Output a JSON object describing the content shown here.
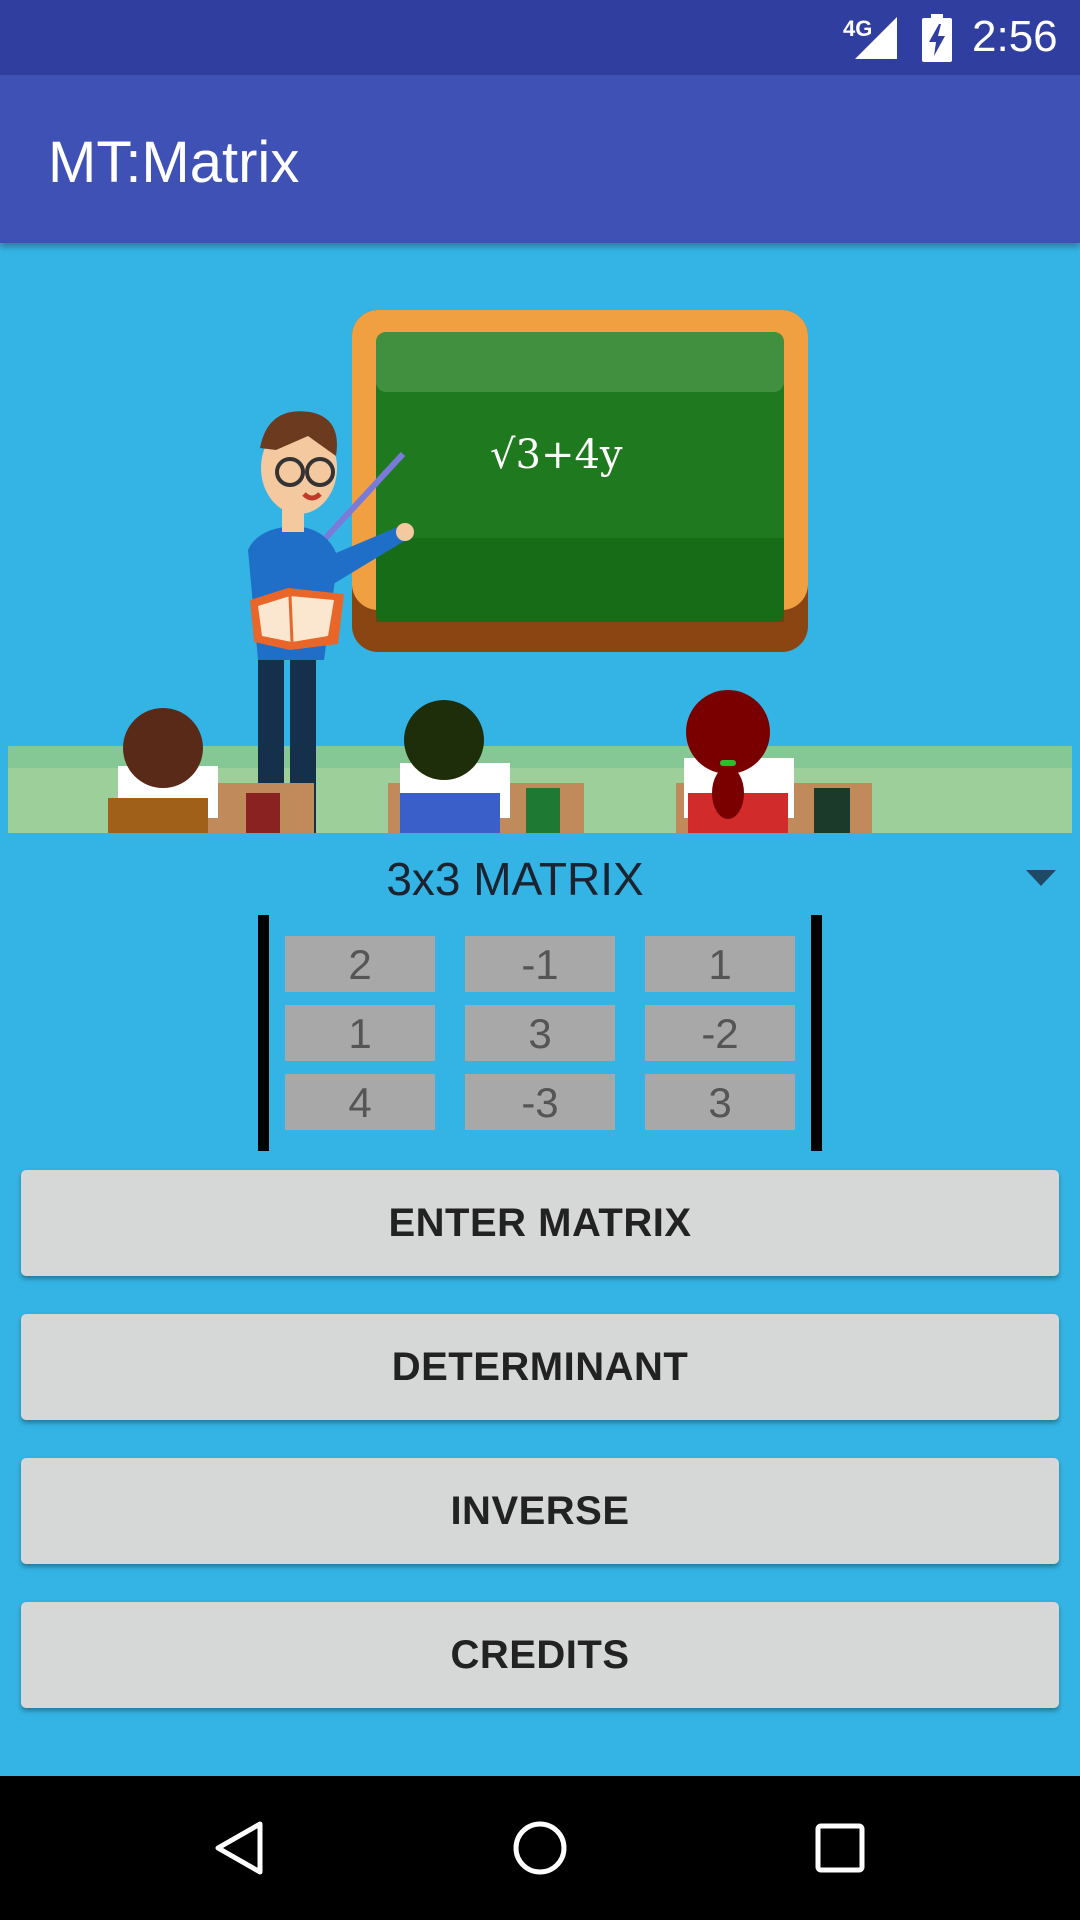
{
  "status_bar": {
    "network": "4G",
    "time": "2:56"
  },
  "app_bar": {
    "title": "MT:Matrix"
  },
  "spinner": {
    "selected": "3x3 MATRIX"
  },
  "matrix": [
    [
      "2",
      "-1",
      "1"
    ],
    [
      "1",
      "3",
      "-2"
    ],
    [
      "4",
      "-3",
      "3"
    ]
  ],
  "buttons": {
    "enter": "ENTER MATRIX",
    "determinant": "DETERMINANT",
    "inverse": "INVERSE",
    "credits": "CREDITS"
  },
  "hero": {
    "chalk_text": "√3+4y"
  },
  "colors": {
    "status_bar": "#303F9F",
    "app_bar": "#3F51B5",
    "background": "#34B4E4",
    "button": "#D6D7D7",
    "cell": "#A8A8A8"
  }
}
